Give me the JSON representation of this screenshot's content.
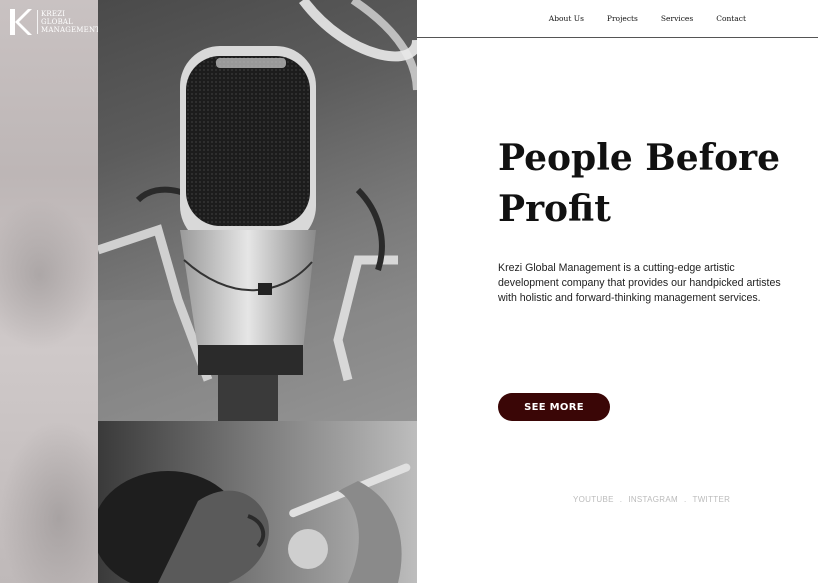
{
  "brand": {
    "line1": "KREZI",
    "line2": "GLOBAL",
    "line3": "MANAGEMENT"
  },
  "nav": {
    "items": [
      "About Us",
      "Projects",
      "Services",
      "Contact"
    ]
  },
  "hero": {
    "title": "People Before Profit",
    "description": "Krezi Global Management is a cutting-edge artistic development company that provides our handpicked artistes with holistic and forward-thinking management services.",
    "cta_label": "SEE MORE"
  },
  "social": {
    "youtube": "YOUTUBE",
    "instagram": "INSTAGRAM",
    "twitter": "TWITTER"
  },
  "colors": {
    "cta_bg": "#3a0606",
    "text": "#111111"
  }
}
